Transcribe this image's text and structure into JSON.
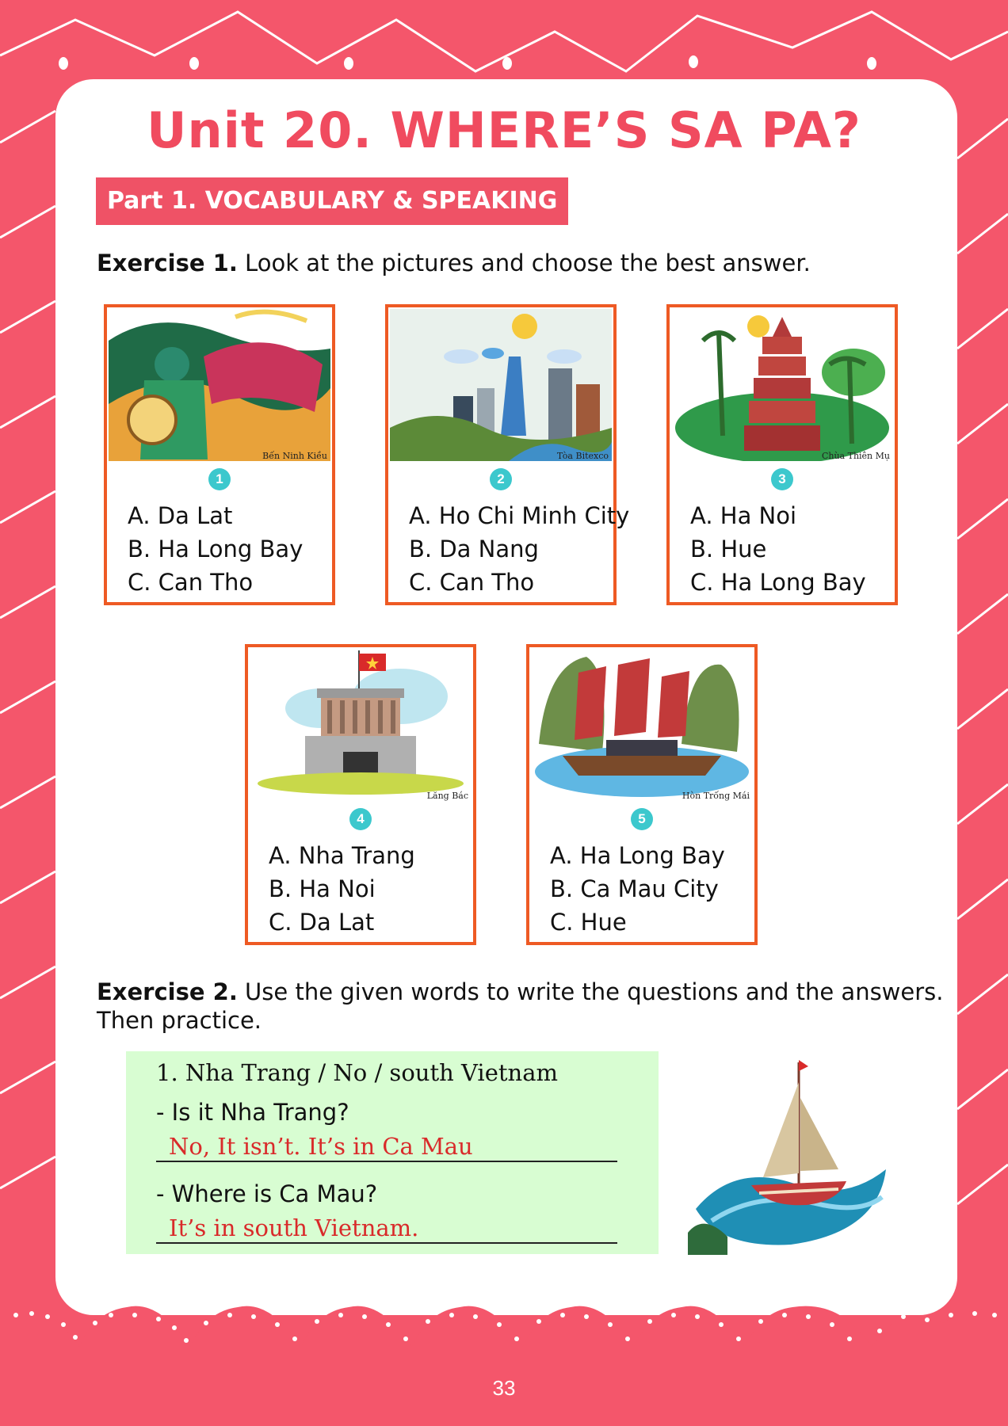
{
  "title": "Unit 20. WHERE’S SA PA?",
  "part_banner": "Part 1. VOCABULARY & SPEAKING",
  "exercise1": {
    "label": "Exercise 1.",
    "instruction": " Look at the pictures and choose the best answer.",
    "items": [
      {
        "number": "1",
        "caption": "Bến Ninh Kiều",
        "options": [
          "A. Da Lat",
          "B. Ha Long Bay",
          "C. Can Tho"
        ]
      },
      {
        "number": "2",
        "caption": "Tòa Bitexco",
        "options": [
          "A. Ho Chi Minh City",
          "B. Da Nang",
          "C. Can Tho"
        ]
      },
      {
        "number": "3",
        "caption": "Chùa Thiên Mụ",
        "options": [
          "A. Ha Noi",
          "B. Hue",
          "C. Ha Long Bay"
        ]
      },
      {
        "number": "4",
        "caption": "Lăng Bác",
        "options": [
          "A. Nha Trang",
          "B. Ha Noi",
          "C. Da Lat"
        ]
      },
      {
        "number": "5",
        "caption": "Hòn Trống Mái",
        "options": [
          "A. Ha Long Bay",
          "B. Ca Mau City",
          "C. Hue"
        ]
      }
    ]
  },
  "exercise2": {
    "label": "Exercise 2.",
    "instruction_line1": " Use the given words to write the questions and the answers.",
    "instruction_line2": "Then practice.",
    "prompt": "1. Nha Trang / No / south Vietnam",
    "question1": "- Is it Nha Trang?",
    "answer1": "No, It isn’t. It’s in Ca Mau",
    "question2": "- Where is Ca Mau?",
    "answer2": "It’s in south Vietnam."
  },
  "page_number": "33",
  "colors": {
    "background": "#f4566b",
    "box_border": "#ee5a24",
    "number_badge": "#3cc8cd",
    "answer_text": "#d92a2a",
    "green_panel": "#d8fdd2"
  }
}
